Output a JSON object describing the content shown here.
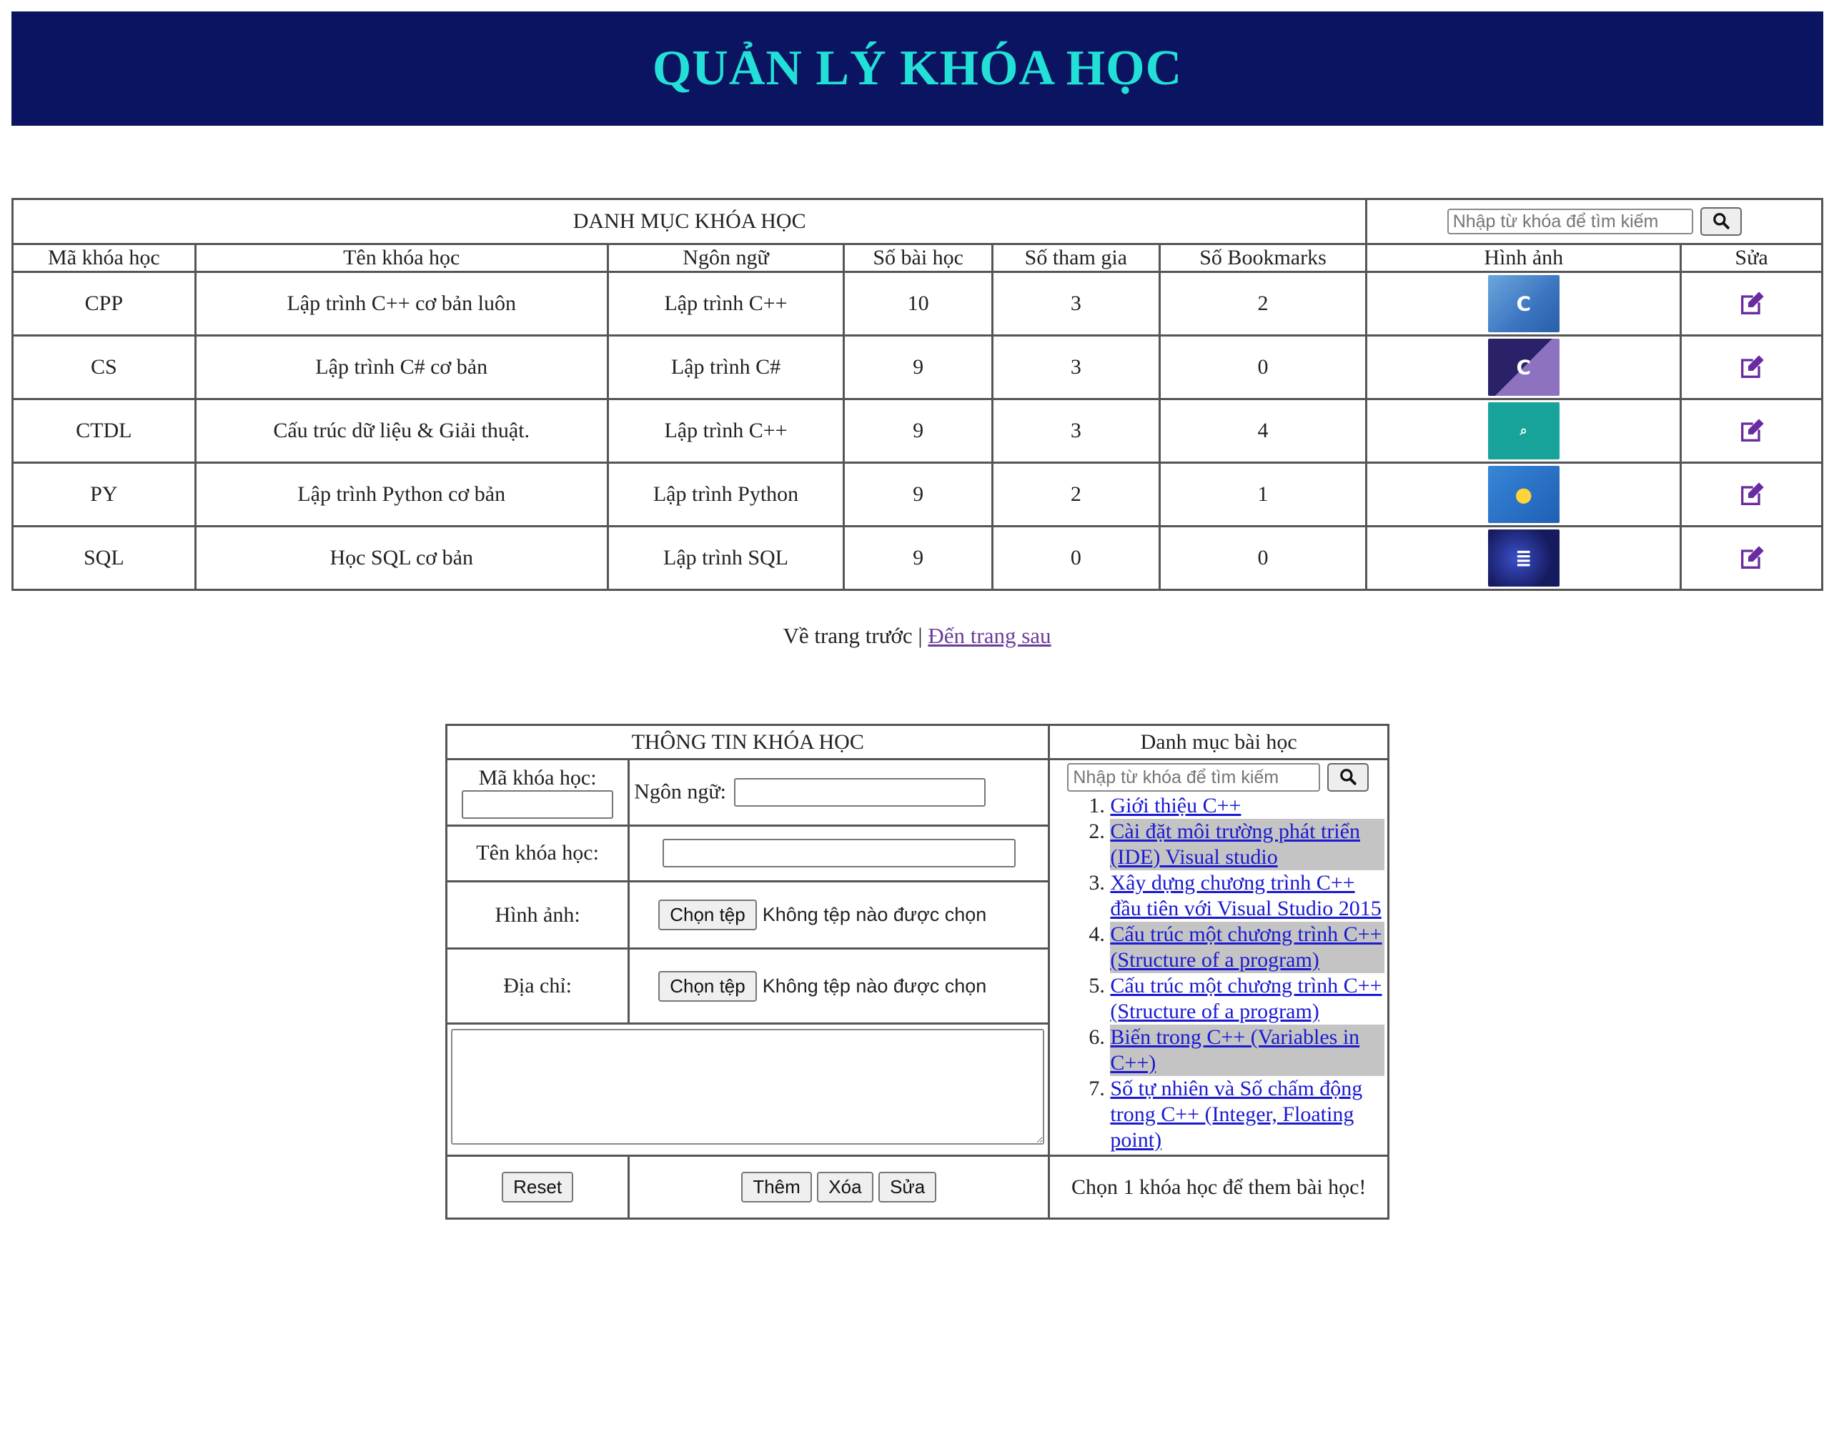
{
  "header": {
    "title": "QUẢN LÝ KHÓA HỌC"
  },
  "course_table": {
    "title": "DANH MỤC KHÓA HỌC",
    "search_placeholder": "Nhập từ khóa để tìm kiếm",
    "columns": [
      "Mã khóa học",
      "Tên khóa học",
      "Ngôn ngữ",
      "Số bài học",
      "Số tham gia",
      "Số Bookmarks",
      "Hình ảnh",
      "Sửa"
    ],
    "rows": [
      {
        "code": "CPP",
        "name": "Lập trình C++ cơ bản luôn",
        "language": "Lập trình C++",
        "lessons": "10",
        "participants": "3",
        "bookmarks": "2",
        "image_icon": "cpp-course-thumbnail"
      },
      {
        "code": "CS",
        "name": "Lập trình C# cơ bản",
        "language": "Lập trình C#",
        "lessons": "9",
        "participants": "3",
        "bookmarks": "0",
        "image_icon": "csharp-course-thumbnail"
      },
      {
        "code": "CTDL",
        "name": "Cấu trúc dữ liệu & Giải thuật.",
        "language": "Lập trình C++",
        "lessons": "9",
        "participants": "3",
        "bookmarks": "4",
        "image_icon": "data-structures-course-thumbnail"
      },
      {
        "code": "PY",
        "name": "Lập trình Python cơ bản",
        "language": "Lập trình Python",
        "lessons": "9",
        "participants": "2",
        "bookmarks": "1",
        "image_icon": "python-course-thumbnail"
      },
      {
        "code": "SQL",
        "name": "Học SQL cơ bản",
        "language": "Lập trình SQL",
        "lessons": "9",
        "participants": "0",
        "bookmarks": "0",
        "image_icon": "sql-course-thumbnail"
      }
    ]
  },
  "pager": {
    "prev": "Về trang trước",
    "separator": "|",
    "next": "Đến trang sau"
  },
  "form": {
    "title": "THÔNG TIN KHÓA HỌC",
    "code_label": "Mã khóa học:",
    "code_value": "",
    "language_label": "Ngôn ngữ:",
    "language_value": "",
    "name_label": "Tên khóa học:",
    "name_value": "",
    "image_label": "Hình ảnh:",
    "address_label": "Địa chỉ:",
    "choose_file": "Chọn tệp",
    "no_file": "Không tệp nào được chọn",
    "description_value": "",
    "reset": "Reset",
    "add": "Thêm",
    "delete": "Xóa",
    "edit": "Sửa"
  },
  "lessons_panel": {
    "title": "Danh mục bài học",
    "search_placeholder": "Nhập từ khóa để tìm kiếm",
    "items": [
      "Giới thiệu C++",
      "Cài đặt môi trường phát triển (IDE) Visual studio",
      "Xây dựng chương trình C++ đầu tiên với Visual Studio 2015",
      "Cấu trúc một chương trình C++ (Structure of a program)",
      "Cấu trúc một chương trình C++ (Structure of a program)",
      "Biến trong C++ (Variables in C++)",
      "Số tự nhiên và Số chấm động trong C++ (Integer, Floating point)"
    ],
    "footer": "Chọn 1 khóa học để them bài học!"
  },
  "colors": {
    "header_bg": "#0b1460",
    "header_text": "#22e0d8",
    "edit_icon": "#6a2aa0",
    "link": "#1a1ad0",
    "highlight_row": "#c4c4c4"
  }
}
